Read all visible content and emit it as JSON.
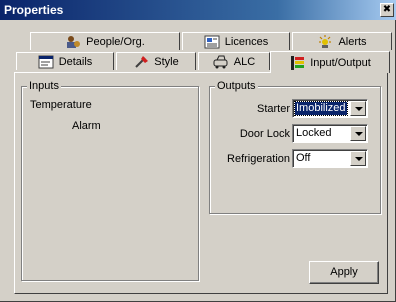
{
  "window": {
    "title": "Properties",
    "close_glyph": "✖"
  },
  "tabs_back": [
    {
      "label": "People/Org.",
      "icon": "people-org-icon"
    },
    {
      "label": "Licences",
      "icon": "licences-icon"
    },
    {
      "label": "Alerts",
      "icon": "alerts-icon"
    }
  ],
  "tabs_front": [
    {
      "label": "Details",
      "icon": "details-icon"
    },
    {
      "label": "Style",
      "icon": "style-icon"
    },
    {
      "label": "ALC",
      "icon": "alc-icon"
    },
    {
      "label": "Input/Output",
      "icon": "input-output-icon",
      "active": true
    }
  ],
  "inputs": {
    "legend": "Inputs",
    "items": [
      "Temperature",
      "Alarm"
    ]
  },
  "outputs": {
    "legend": "Outputs",
    "rows": [
      {
        "label": "Starter",
        "value": "Imobilized",
        "selected": true
      },
      {
        "label": "Door Lock",
        "value": "Locked"
      },
      {
        "label": "Refrigeration",
        "value": "Off"
      }
    ]
  },
  "apply_label": "Apply",
  "colors": {
    "title_start": "#0a246a",
    "title_end": "#a6caf0",
    "face": "#d4d0c8",
    "selection": "#0a246a"
  }
}
